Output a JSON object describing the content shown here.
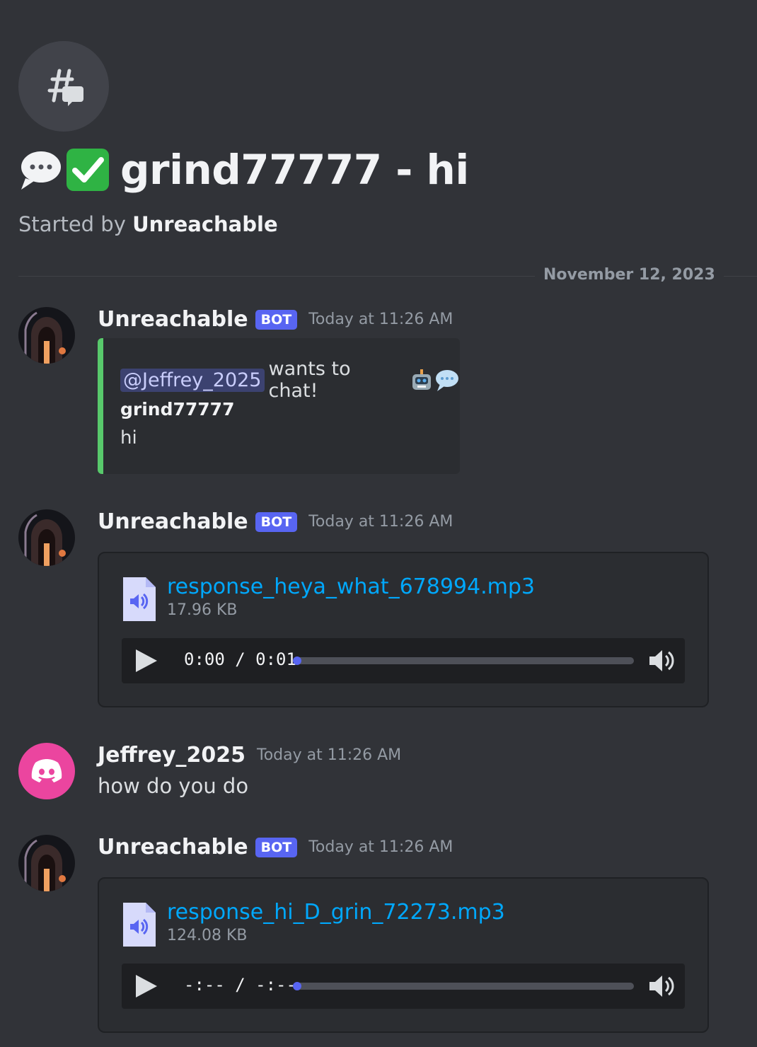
{
  "thread": {
    "title": "grind77777 - hi",
    "started_prefix": "Started by",
    "started_by": "Unreachable"
  },
  "divider": {
    "date": "November 12, 2023"
  },
  "messages": [
    {
      "author": "Unreachable",
      "tag": "BOT",
      "timestamp": "Today at 11:26 AM",
      "embed": {
        "mention": "@Jeffrey_2025",
        "text": "wants to chat!",
        "field_name": "grind77777",
        "field_value": "hi",
        "accent_color": "#58c96b"
      }
    },
    {
      "author": "Unreachable",
      "tag": "BOT",
      "timestamp": "Today at 11:26 AM",
      "attachment": {
        "file_name": "response_heya_what_678994.mp3",
        "file_size": "17.96 KB",
        "time_display": "0:00 / 0:01",
        "progress": 0
      }
    },
    {
      "author": "Jeffrey_2025",
      "timestamp": "Today at 11:26 AM",
      "content": "how do you do",
      "avatar_color": "#eb459f"
    },
    {
      "author": "Unreachable",
      "tag": "BOT",
      "timestamp": "Today at 11:26 AM",
      "attachment": {
        "file_name": "response_hi_D_grin_72273.mp3",
        "file_size": "124.08 KB",
        "time_display": "-:-- / -:--",
        "progress": 0
      }
    }
  ],
  "colors": {
    "accent": "#5865f2",
    "link": "#00a8fc",
    "background": "#313338"
  },
  "icons": [
    "thread-icon",
    "speech-bubble-emoji",
    "check-mark-emoji",
    "robot-emoji",
    "audio-file-icon",
    "play-icon",
    "volume-icon",
    "discord-logo-icon"
  ]
}
